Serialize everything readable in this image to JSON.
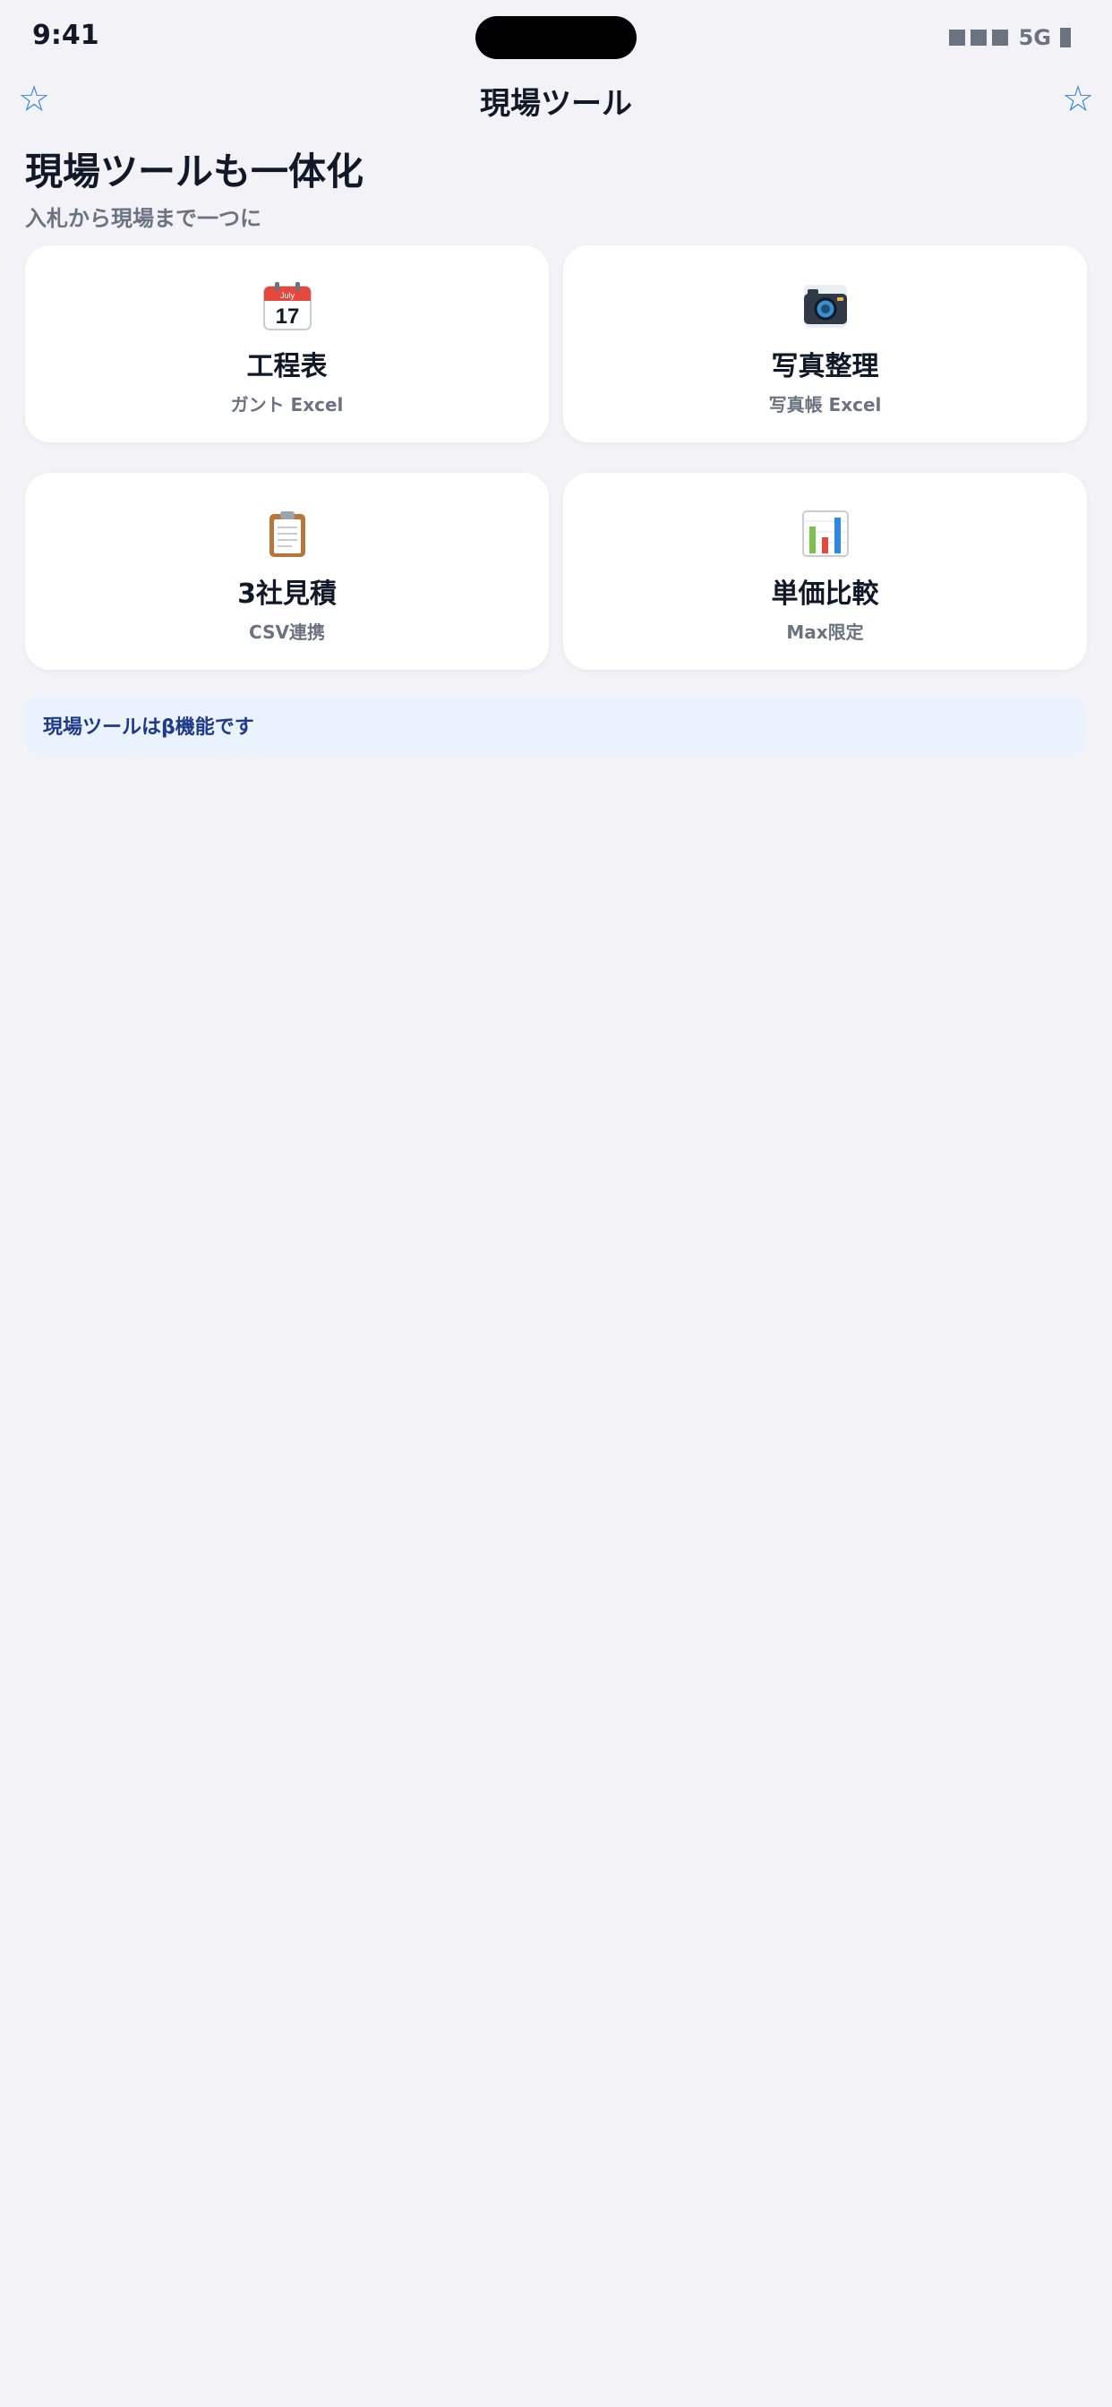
{
  "status_bar": {
    "time": "9:41",
    "network": "5G"
  },
  "nav": {
    "title": "現場ツール",
    "left_icon": "star-outline-icon",
    "right_icon": "star-outline-icon",
    "left_glyph": "☆",
    "right_glyph": "☆"
  },
  "header": {
    "title": "現場ツールも一体化",
    "subtitle": "入札から現場まで一つに"
  },
  "tools": [
    {
      "icon": "calendar-icon",
      "title": "工程表",
      "subtitle": "ガント Excel",
      "calendar_month": "July",
      "calendar_day": "17"
    },
    {
      "icon": "camera-icon",
      "title": "写真整理",
      "subtitle": "写真帳 Excel"
    },
    {
      "icon": "clipboard-icon",
      "title": "3社見積",
      "subtitle": "CSV連携"
    },
    {
      "icon": "bar-chart-icon",
      "title": "単価比較",
      "subtitle": "Max限定"
    }
  ],
  "banner": {
    "text": "現場ツールはβ機能です"
  },
  "colors": {
    "background": "#f2f2f7",
    "accent": "#2f86e4",
    "banner_bg": "#eaf2fd",
    "banner_text": "#1e3a8a"
  }
}
